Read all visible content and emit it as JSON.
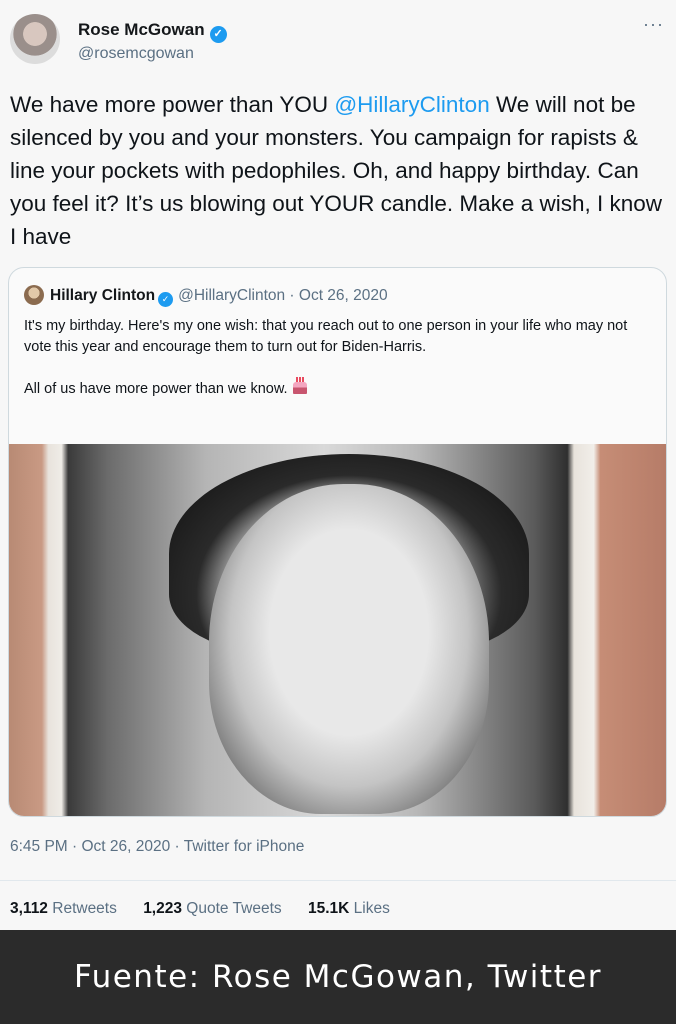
{
  "author": {
    "name": "Rose McGowan",
    "handle": "@rosemcgowan"
  },
  "tweet": {
    "text_before": "We have more power than YOU ",
    "mention": "@HillaryClinton",
    "text_after": " We will not be silenced by you and your monsters. You campaign for rapists & line your pockets with pedophiles. Oh, and happy birthday. Can you feel it? It’s us blowing out YOUR candle. Make a wish, I know I have"
  },
  "quoted_tweet": {
    "name": "Hillary Clinton",
    "meta": "@HillaryClinton · Oct 26, 2020",
    "paragraph1": "It's my birthday. Here's my one wish: that you reach out to one person in your life who may not vote this year and encourage them to turn out for Biden-Harris.",
    "paragraph2": "All of us have more power than we know."
  },
  "timestamp": "6:45 PM · Oct 26, 2020 · Twitter for iPhone",
  "stats": {
    "retweets_count": "3,112",
    "retweets_label": "Retweets",
    "quotes_count": "1,223",
    "quotes_label": "Quote Tweets",
    "likes_count": "15.1K",
    "likes_label": "Likes"
  },
  "caption": "Fuente: Rose McGowan, Twitter",
  "colors": {
    "link": "#1d9bf0",
    "secondary_text": "#5b7083",
    "caption_bar": "#2b2b2b"
  }
}
